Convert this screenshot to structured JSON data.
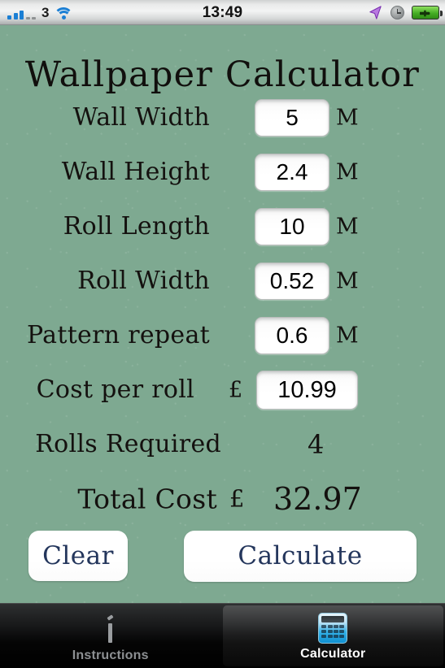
{
  "status_bar": {
    "signal_label": "3",
    "signal_bars_filled": 3,
    "signal_bars_empty": 2,
    "wifi_icon": "wifi-icon",
    "time": "13:49",
    "location_icon": "location-arrow-icon",
    "alarm_icon": "alarm-clock-icon",
    "battery_icon": "battery-charging-icon",
    "colors": {
      "signal": "#1b7fd4",
      "location": "#a34fd6",
      "battery": "#45ad24"
    }
  },
  "app": {
    "title": "Wallpaper Calculator",
    "background_color": "#7ea991",
    "text_color": "#14110f"
  },
  "fields": [
    {
      "label": "Wall Width",
      "value": "5",
      "unit": "M",
      "currency": "",
      "name": "wall-width"
    },
    {
      "label": "Wall Height",
      "value": "2.4",
      "unit": "M",
      "currency": "",
      "name": "wall-height"
    },
    {
      "label": "Roll Length",
      "value": "10",
      "unit": "M",
      "currency": "",
      "name": "roll-length"
    },
    {
      "label": "Roll Width",
      "value": "0.52",
      "unit": "M",
      "currency": "",
      "name": "roll-width"
    },
    {
      "label": "Pattern repeat",
      "value": "0.6",
      "unit": "M",
      "currency": "",
      "name": "pattern-repeat"
    },
    {
      "label": "Cost per roll",
      "value": "10.99",
      "unit": "",
      "currency": "£",
      "name": "cost-per-roll"
    }
  ],
  "results": [
    {
      "label": "Rolls Required",
      "value": "4",
      "currency": ""
    },
    {
      "label": "Total Cost",
      "value": "32.97",
      "currency": "£"
    }
  ],
  "buttons": {
    "clear": "Clear",
    "calculate": "Calculate",
    "text_color": "#24365c"
  },
  "tabs": [
    {
      "label": "Instructions",
      "icon": "info-icon",
      "selected": false
    },
    {
      "label": "Calculator",
      "icon": "calculator-icon",
      "selected": true
    }
  ]
}
